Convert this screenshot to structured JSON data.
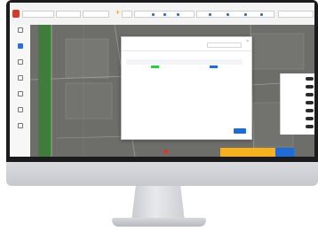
{
  "toolbar": {
    "groups": [
      "",
      "",
      "",
      "",
      "",
      "",
      ""
    ],
    "add_symbol": "+"
  },
  "sidebar": {
    "items": [
      {
        "label": "",
        "icon": "layers-icon"
      },
      {
        "label": "",
        "icon": "map-pin-icon"
      },
      {
        "label": "",
        "icon": "route-icon"
      },
      {
        "label": "",
        "icon": "document-icon"
      },
      {
        "label": "",
        "icon": "user-icon"
      },
      {
        "label": "",
        "icon": "chart-icon"
      },
      {
        "label": "",
        "icon": "settings-icon"
      }
    ]
  },
  "dialog": {
    "title": "",
    "search_placeholder": "",
    "section_label": "",
    "columns": [
      "",
      "",
      "",
      "",
      "",
      "",
      ""
    ],
    "rows": [
      [
        "",
        "",
        "",
        "",
        "",
        "",
        ""
      ]
    ],
    "pager": "",
    "confirm_label": ""
  },
  "side_panel": {
    "rows": [
      "",
      "",
      "",
      "",
      "",
      "",
      ""
    ]
  },
  "status": {
    "yellow_text": ""
  },
  "colors": {
    "accent_blue": "#1f6cd6",
    "status_green": "#2ecc40",
    "warning_yellow": "#f5b21c",
    "alert_red": "#e02b2b",
    "map_background": "#6d6e6a"
  }
}
